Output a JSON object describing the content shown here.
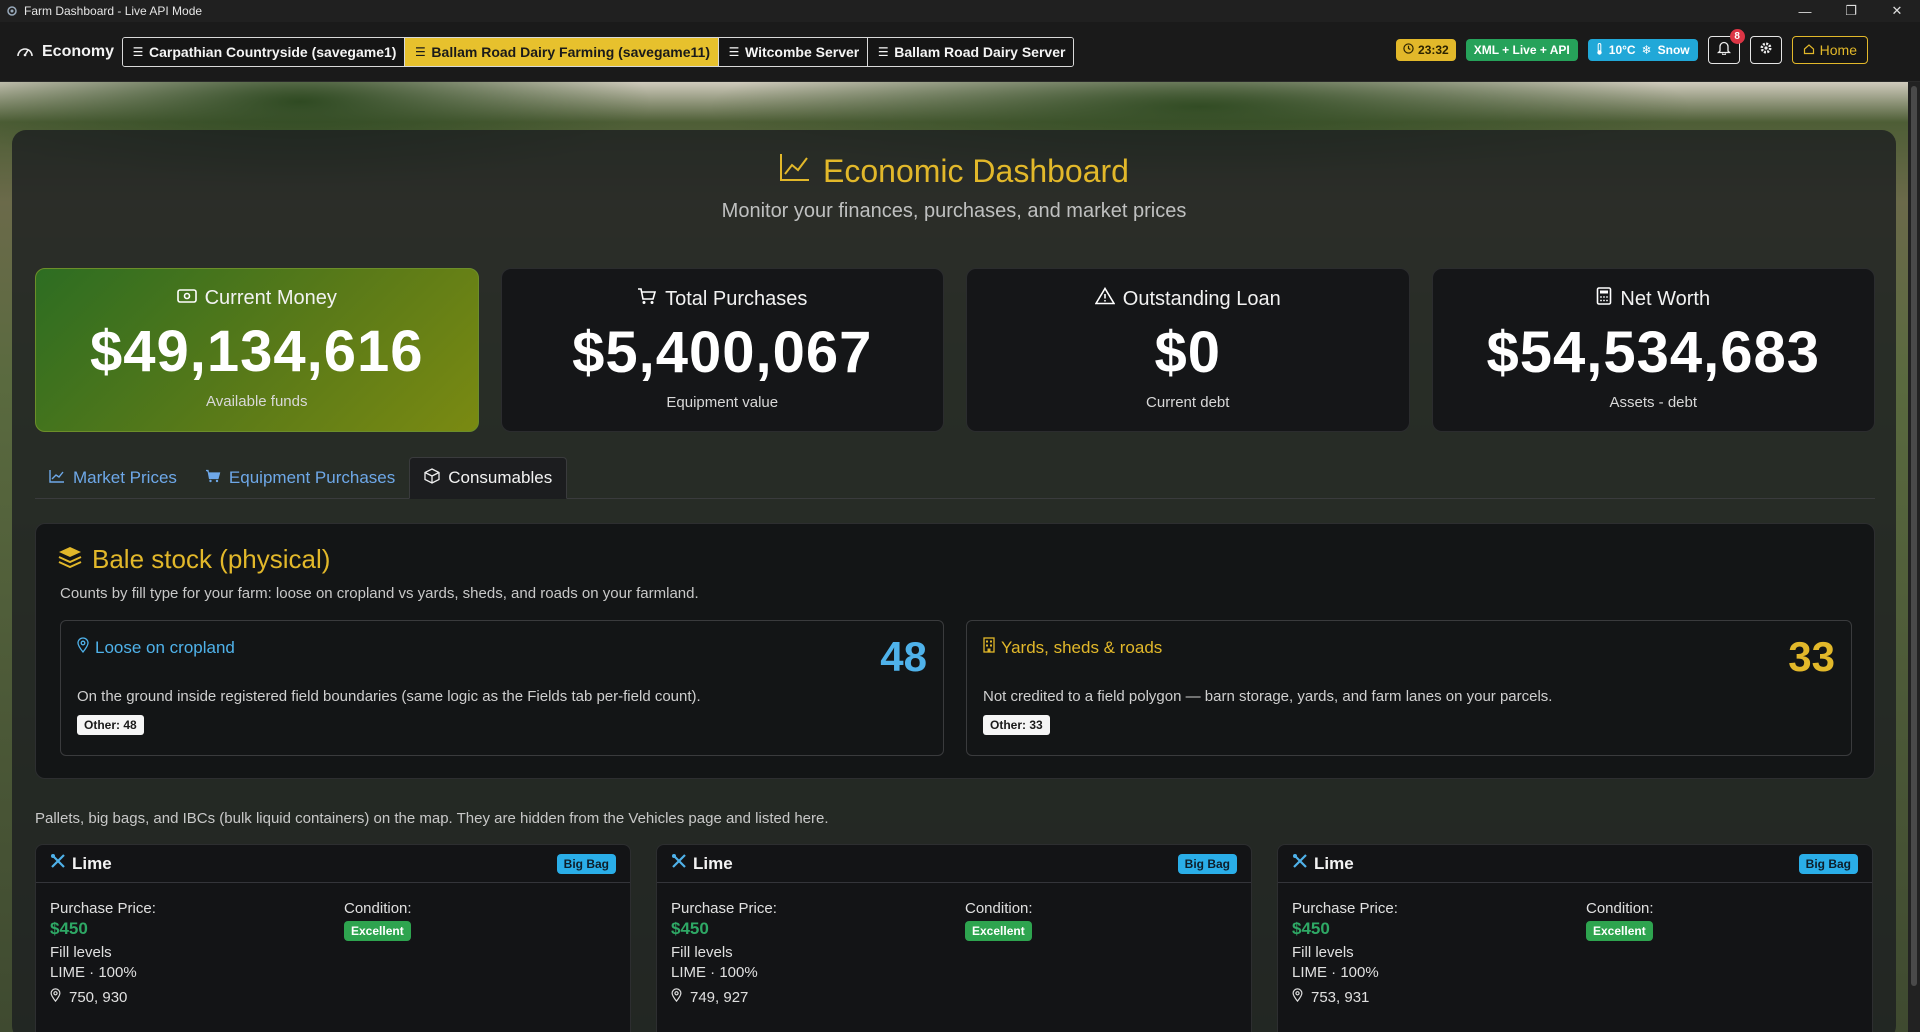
{
  "window": {
    "title": "Farm Dashboard - Live API Mode",
    "controls": [
      "minimize-icon",
      "restore-icon",
      "close-icon"
    ]
  },
  "navbar": {
    "brand": "Economy",
    "servers": [
      {
        "label": "Carpathian Countryside (savegame1)",
        "active": false
      },
      {
        "label": "Ballam Road Dairy Farming (savegame11)",
        "active": true
      },
      {
        "label": "Witcombe Server",
        "active": false
      },
      {
        "label": "Ballam Road Dairy Server",
        "active": false
      }
    ],
    "time": "23:32",
    "mode": "XML + Live + API",
    "weather": {
      "temp": "10°C",
      "condition": "Snow"
    },
    "notifications": "8",
    "home_label": "Home"
  },
  "page": {
    "title": "Economic Dashboard",
    "subtitle": "Monitor your finances, purchases, and market prices"
  },
  "stats": [
    {
      "label": "Current Money",
      "value": "$49,134,616",
      "sub": "Available funds",
      "icon": "wallet-icon"
    },
    {
      "label": "Total Purchases",
      "value": "$5,400,067",
      "sub": "Equipment value",
      "icon": "cart-icon"
    },
    {
      "label": "Outstanding Loan",
      "value": "$0",
      "sub": "Current debt",
      "icon": "warning-icon"
    },
    {
      "label": "Net Worth",
      "value": "$54,534,683",
      "sub": "Assets - debt",
      "icon": "calculator-icon"
    }
  ],
  "tabs": [
    {
      "label": "Market Prices",
      "active": false
    },
    {
      "label": "Equipment Purchases",
      "active": false
    },
    {
      "label": "Consumables",
      "active": true
    }
  ],
  "bale": {
    "title": "Bale stock (physical)",
    "desc": "Counts by fill type for your farm: loose on cropland vs yards, sheds, and roads on your farmland.",
    "left": {
      "title": "Loose on cropland",
      "count": "48",
      "desc": "On the ground inside registered field boundaries (same logic as the Fields tab per-field count).",
      "pill": "Other: 48"
    },
    "right": {
      "title": "Yards, sheds & roads",
      "count": "33",
      "desc": "Not credited to a field polygon — barn storage, yards, and farm lanes on your parcels.",
      "pill": "Other: 33"
    }
  },
  "pallet_note": "Pallets, big bags, and IBCs (bulk liquid containers) on the map. They are hidden from the Vehicles page and listed here.",
  "item_labels": {
    "price": "Purchase Price:",
    "condition": "Condition:",
    "fill": "Fill levels"
  },
  "items": [
    {
      "name": "Lime",
      "type": "Big Bag",
      "price": "$450",
      "condition": "Excellent",
      "fill": "LIME · 100%",
      "coords": "750, 930"
    },
    {
      "name": "Lime",
      "type": "Big Bag",
      "price": "$450",
      "condition": "Excellent",
      "fill": "LIME · 100%",
      "coords": "749, 927"
    },
    {
      "name": "Lime",
      "type": "Big Bag",
      "price": "$450",
      "condition": "Excellent",
      "fill": "LIME · 100%",
      "coords": "753, 931"
    }
  ],
  "colors": {
    "accent": "#e2b82a",
    "link": "#6ea8e8",
    "success": "#2ea865",
    "info": "#2aaee8"
  }
}
